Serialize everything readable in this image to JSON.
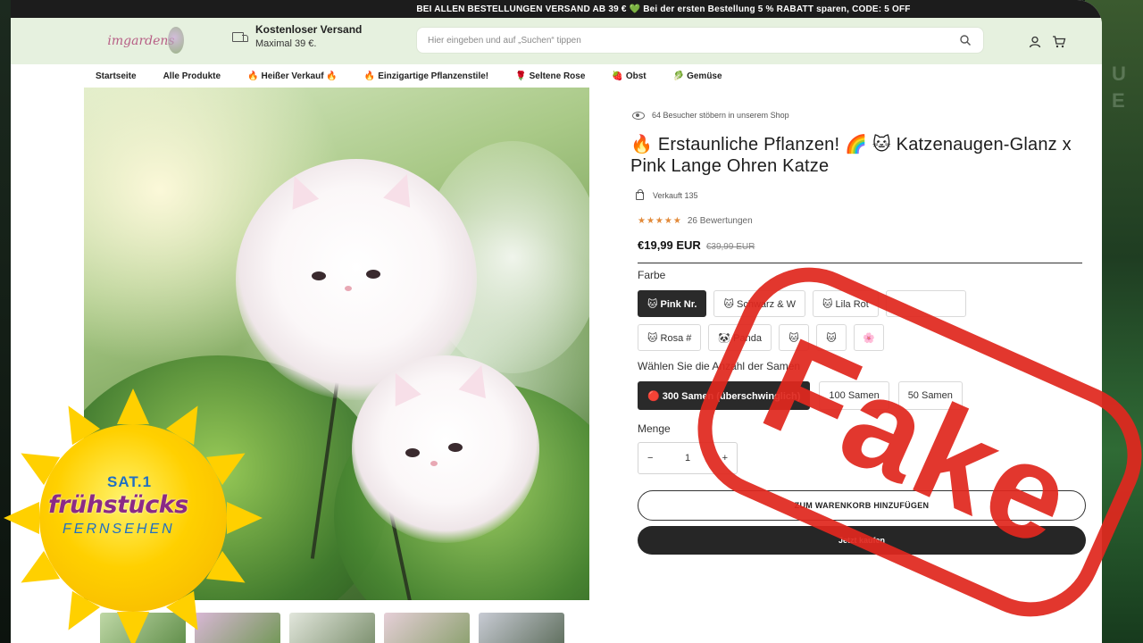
{
  "promo": "BEI ALLEN BESTELLUNGEN VERSAND AB 39 € 💚 Bei der ersten Bestellung 5 % RABATT sparen, CODE: 5 OFF",
  "header": {
    "logo_text": "imgardens",
    "shipping_title": "Kostenloser Versand",
    "shipping_sub": "Maximal 39 €.",
    "search_placeholder": "Hier eingeben und auf „Suchen“ tippen"
  },
  "nav": [
    {
      "emoji": "",
      "label": "Startseite"
    },
    {
      "emoji": "",
      "label": "Alle Produkte"
    },
    {
      "emoji": "🔥",
      "label": "Heißer Verkauf 🔥"
    },
    {
      "emoji": "🔥",
      "label": "Einzigartige Pflanzenstile!"
    },
    {
      "emoji": "🌹",
      "label": "Seltene Rose"
    },
    {
      "emoji": "🍓",
      "label": "Obst"
    },
    {
      "emoji": "🥬",
      "label": "Gemüse"
    }
  ],
  "product": {
    "visitors": "64 Besucher stöbern in unserem Shop",
    "title": "🔥 Erstaunliche Pflanzen! 🌈 🐱 Katzenaugen-Glanz x Pink Lange Ohren Katze",
    "sold": "Verkauft 135",
    "stars": "★★★★★",
    "reviews": "26 Bewertungen",
    "price": "€19,99 EUR",
    "old_price": "€39,99 EUR",
    "color_label": "Farbe",
    "colors": [
      "🐱 Pink Nr.",
      "🐱 Schwarz & W",
      "🐱 Lila Rot",
      "",
      "🐱 Rosa #",
      "🐼 Panda",
      "🐱",
      "🐱",
      "🌸"
    ],
    "selected_color": 0,
    "seed_label": "Wählen Sie die Anzahl der Samen",
    "seed_options": [
      "🔴 300 Samen (überschwinglich)",
      "100 Samen",
      "50 Samen"
    ],
    "selected_seed": 0,
    "qty_label": "Menge",
    "qty_minus": "−",
    "qty_value": "1",
    "qty_plus": "+",
    "add_to_cart": "ZUM WARENKORB HINZUFÜGEN",
    "buy_now": "Jetzt kaufen"
  },
  "stamp": "Fake",
  "tv": {
    "channel": "SAT.1",
    "show": "frühstücks",
    "sub": "FERNSEHEN"
  }
}
